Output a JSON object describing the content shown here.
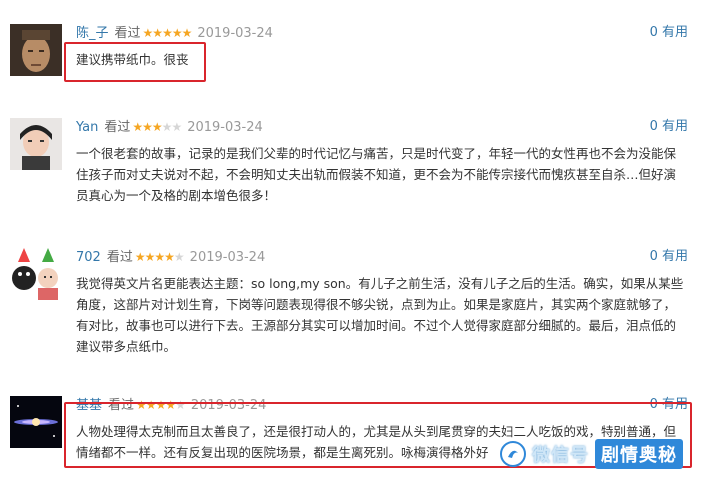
{
  "reviews": [
    {
      "user": "陈_子",
      "watched": "看过",
      "stars_filled": 5,
      "date": "2019-03-24",
      "useful_count": "0",
      "useful_label": "有用",
      "content": "建议携带纸巾。很丧"
    },
    {
      "user": "Yan",
      "watched": "看过",
      "stars_filled": 3,
      "date": "2019-03-24",
      "useful_count": "0",
      "useful_label": "有用",
      "content": "一个很老套的故事，记录的是我们父辈的时代记忆与痛苦，只是时代变了，年轻一代的女性再也不会为没能保住孩子而对丈夫说对不起，不会明知丈夫出轨而假装不知道，更不会为不能传宗接代而愧疚甚至自杀…但好演员真心为一个及格的剧本增色很多！"
    },
    {
      "user": "702",
      "watched": "看过",
      "stars_filled": 4,
      "date": "2019-03-24",
      "useful_count": "0",
      "useful_label": "有用",
      "content": "我觉得英文片名更能表达主题：so long,my son。有儿子之前生活，没有儿子之后的生活。确实，如果从某些角度，这部片对计划生育，下岗等问题表现得很不够尖锐，点到为止。如果是家庭片，其实两个家庭就够了，有对比，故事也可以进行下去。王源部分其实可以增加时间。不过个人觉得家庭部分细腻的。最后，泪点低的建议带多点纸巾。"
    },
    {
      "user": "基基",
      "watched": "看过",
      "stars_filled": 4,
      "date": "2019-03-24",
      "useful_count": "0",
      "useful_label": "有用",
      "content": "人物处理得太克制而且太善良了，还是很打动人的，尤其是从头到尾贯穿的夫妇二人吃饭的戏，特别普通，但情绪都不一样。还有反复出现的医院场景，都是生离死别。咏梅演得格外好"
    }
  ],
  "watermark": {
    "text": "微信号",
    "brand": "剧情奥秘"
  },
  "colors": {
    "link": "#3377aa",
    "star": "#f5a623",
    "highlight": "#d9252c"
  }
}
